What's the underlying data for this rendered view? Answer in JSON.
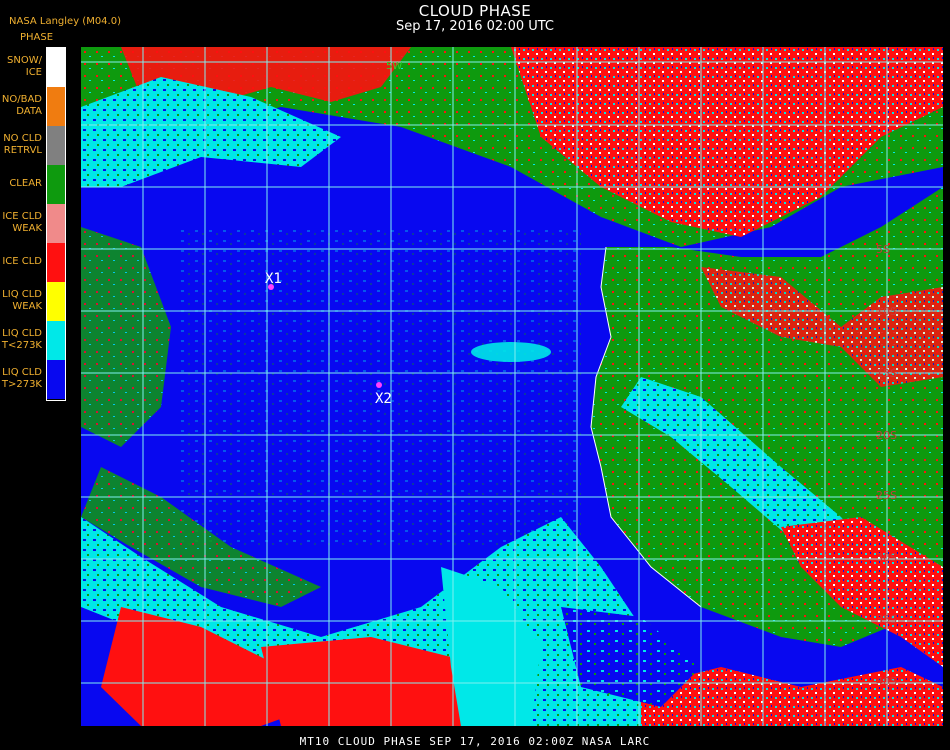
{
  "header": {
    "title": "CLOUD PHASE",
    "subtitle": "Sep 17, 2016 02:00 UTC",
    "provider": "NASA Langley (M04.0)"
  },
  "legend": {
    "title": "PHASE",
    "items": [
      {
        "label": "SNOW/\nICE",
        "color": "#ffffff"
      },
      {
        "label": "NO/BAD\nDATA",
        "color": "#f07c10"
      },
      {
        "label": "NO CLD\nRETRVL",
        "color": "#808080"
      },
      {
        "label": "CLEAR",
        "color": "#0e9a0e"
      },
      {
        "label": "ICE CLD\nWEAK",
        "color": "#f08a8a"
      },
      {
        "label": "ICE CLD",
        "color": "#ff1010"
      },
      {
        "label": "LIQ CLD\nWEAK",
        "color": "#ffff00"
      },
      {
        "label": "LIQ CLD\nT<273K",
        "color": "#00e8e8"
      },
      {
        "label": "LIQ CLD\nT>273K",
        "color": "#0808f0"
      }
    ]
  },
  "map": {
    "grid_color": "#80f0f0",
    "latitude_labels": [
      "5S",
      "10S",
      "15S",
      "20S",
      "25S",
      "30S",
      "35S",
      "40S"
    ],
    "longitude_label_top": "5W",
    "markers": [
      {
        "label": "X1",
        "color": "#ff40ff"
      },
      {
        "label": "X2",
        "color": "#ff40ff"
      }
    ]
  },
  "footer": {
    "text": "MT10  CLOUD PHASE   SEP 17, 2016 02:00Z   NASA LARC"
  }
}
